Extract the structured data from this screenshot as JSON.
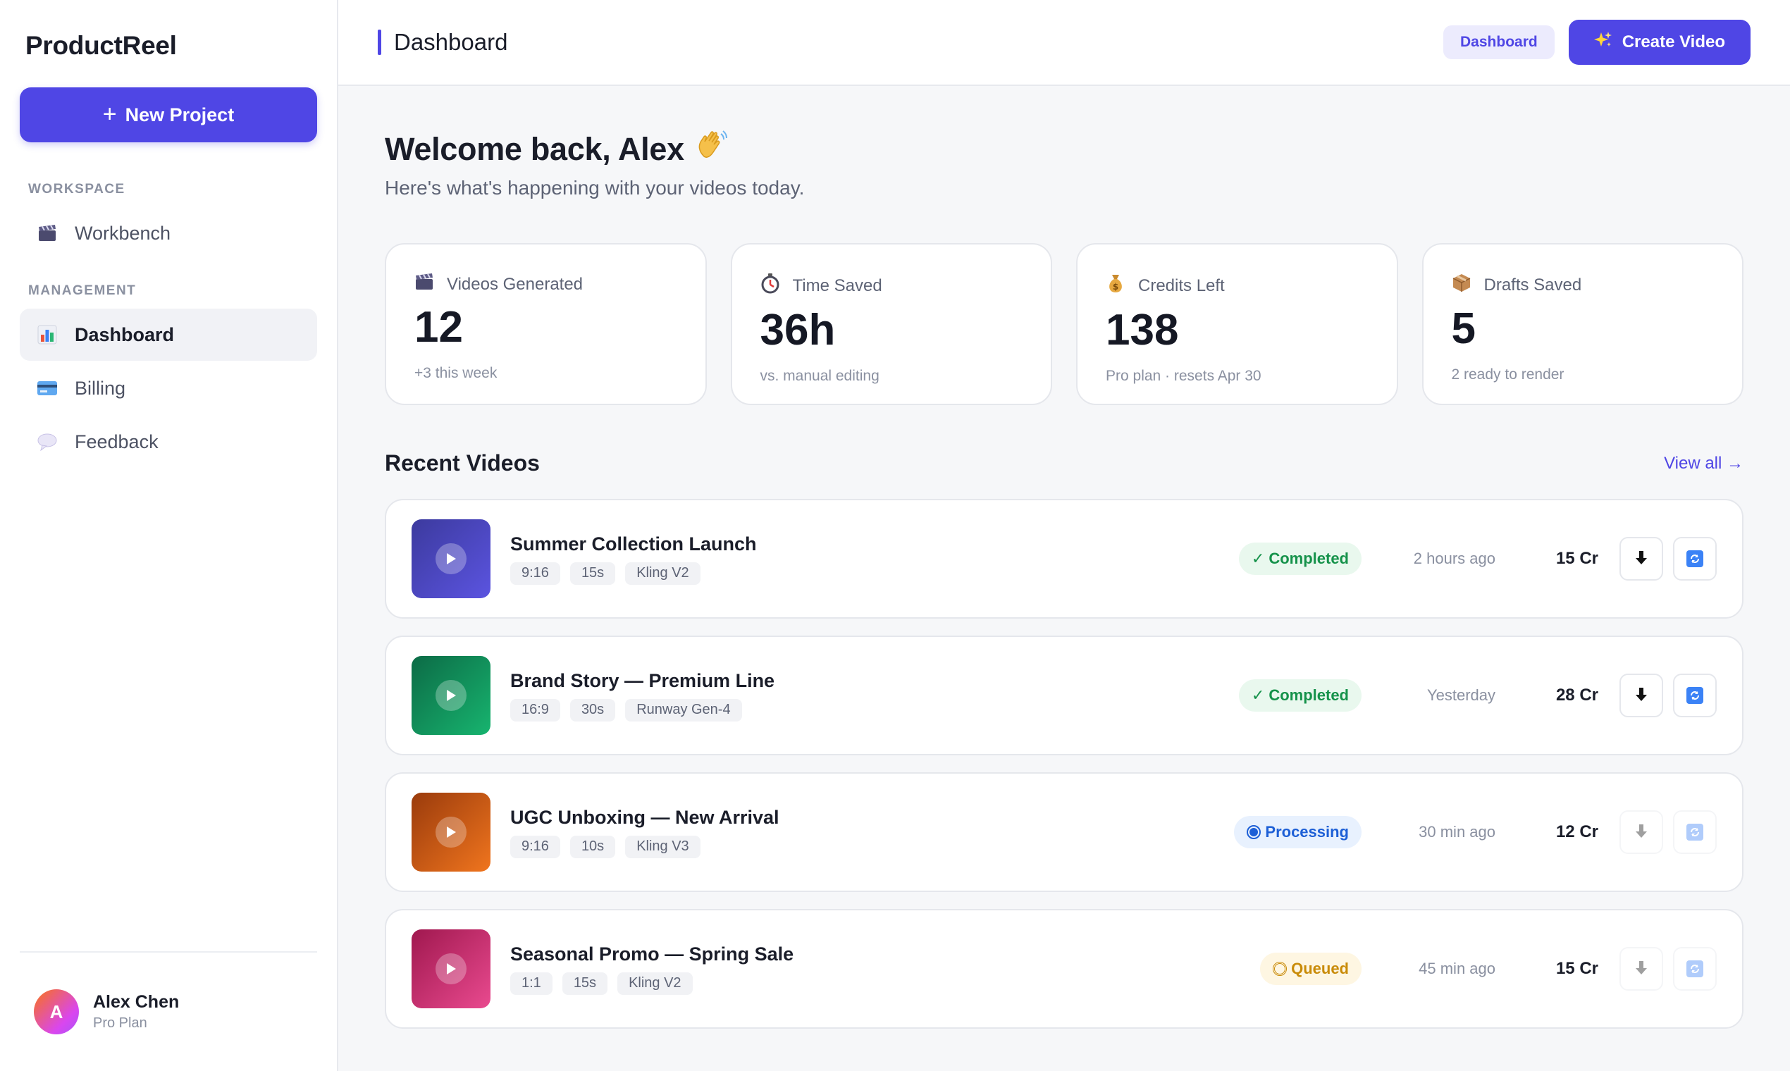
{
  "brand": "ProductReel",
  "sidebar": {
    "new_project": "New Project",
    "sections": [
      {
        "label": "WORKSPACE",
        "items": [
          {
            "label": "Workbench",
            "icon": "clapperboard-icon"
          }
        ]
      },
      {
        "label": "MANAGEMENT",
        "items": [
          {
            "label": "Dashboard",
            "icon": "bar-chart-icon",
            "active": true
          },
          {
            "label": "Billing",
            "icon": "credit-card-icon"
          },
          {
            "label": "Feedback",
            "icon": "speech-bubble-icon"
          }
        ]
      }
    ],
    "user": {
      "initial": "A",
      "name": "Alex Chen",
      "plan": "Pro Plan"
    }
  },
  "header": {
    "title": "Dashboard",
    "chip": "Dashboard",
    "create_video": "Create Video"
  },
  "welcome": {
    "title": "Welcome back, Alex",
    "subtitle": "Here's what's happening with your videos today."
  },
  "stats": [
    {
      "label": "Videos Generated",
      "value": "12",
      "note": "+3 this week",
      "icon": "clapperboard-icon"
    },
    {
      "label": "Time Saved",
      "value": "36h",
      "note": "vs. manual editing",
      "icon": "stopwatch-icon"
    },
    {
      "label": "Credits Left",
      "value": "138",
      "note": "Pro plan · resets Apr 30",
      "icon": "money-bag-icon"
    },
    {
      "label": "Drafts Saved",
      "value": "5",
      "note": "2 ready to render",
      "icon": "package-icon"
    }
  ],
  "recent": {
    "title": "Recent Videos",
    "view_all": "View all →",
    "videos": [
      {
        "title": "Summer Collection Launch",
        "tags": [
          "9:16",
          "15s",
          "Kling V2"
        ],
        "status": "Completed",
        "time": "2 hours ago",
        "cost": "15 Cr",
        "thumb_colors": [
          "#3c3a9e",
          "#5b54e0"
        ]
      },
      {
        "title": "Brand Story — Premium Line",
        "tags": [
          "16:9",
          "30s",
          "Runway Gen-4"
        ],
        "status": "Completed",
        "time": "Yesterday",
        "cost": "28 Cr",
        "thumb_colors": [
          "#0c6b46",
          "#17b46f"
        ]
      },
      {
        "title": "UGC Unboxing — New Arrival",
        "tags": [
          "9:16",
          "10s",
          "Kling V3"
        ],
        "status": "Processing",
        "time": "30 min ago",
        "cost": "12 Cr",
        "thumb_colors": [
          "#9a3b0c",
          "#f0751e"
        ]
      },
      {
        "title": "Seasonal Promo — Spring Sale",
        "tags": [
          "1:1",
          "15s",
          "Kling V2"
        ],
        "status": "Queued",
        "time": "45 min ago",
        "cost": "15 Cr",
        "thumb_colors": [
          "#a0184f",
          "#e94a8f"
        ]
      }
    ]
  },
  "colors": {
    "accent": "#4f46e5",
    "completed": "#15924a",
    "processing": "#1d5fd6",
    "queued": "#c98b08"
  }
}
